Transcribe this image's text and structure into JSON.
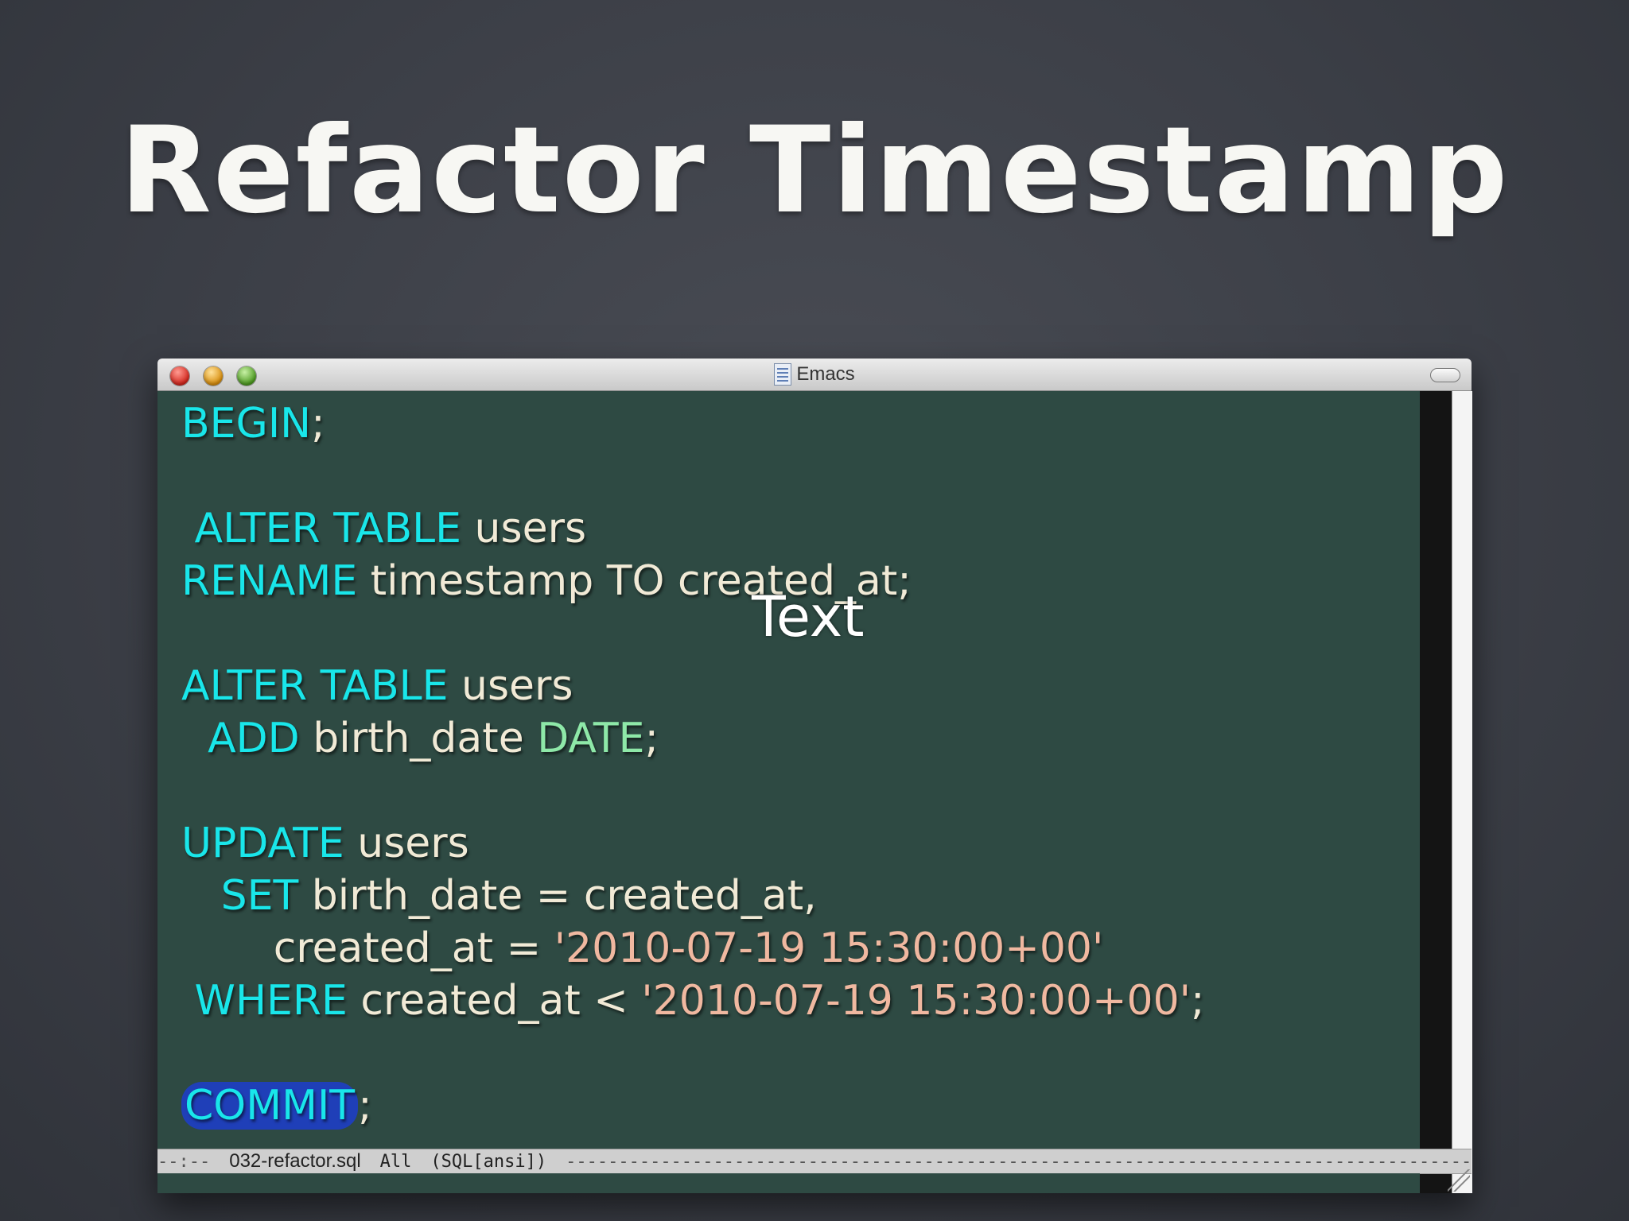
{
  "slide": {
    "title": "Refactor Timestamp"
  },
  "window": {
    "title": "Emacs",
    "icons": {
      "close": "close-traffic-light-icon",
      "minimize": "minimize-traffic-light-icon",
      "zoom": "zoom-traffic-light-icon",
      "document": "document-icon"
    }
  },
  "editor": {
    "theme": {
      "background": "#2e4a43",
      "keyword": "#19e6ea",
      "type": "#8ee8a8",
      "string": "#f0b8a0",
      "text": "#f1ead6"
    },
    "code": {
      "begin": "BEGIN",
      "semi": ";",
      "alter_table_1": "ALTER TABLE",
      "users_1": " users",
      "rename": "RENAME",
      "rename_rest": " timestamp TO created_at;",
      "alter_table_2": "ALTER TABLE",
      "users_2": " users",
      "add": "ADD",
      "add_rest": " birth_date ",
      "date_type": "DATE",
      "semi_2": ";",
      "update": "UPDATE",
      "users_3": " users",
      "set": "SET",
      "set_rest": " birth_date = created_at,",
      "created_at_assign": "created_at = ",
      "timestamp_literal_1": "'2010-07-19 15:30:00+00'",
      "where": "WHERE",
      "where_rest": " created_at < ",
      "timestamp_literal_2": "'2010-07-19 15:30:00+00'",
      "semi_3": ";",
      "commit": "COMMIT",
      "semi_4": ";"
    },
    "cursor_overlay_text": "Text"
  },
  "modeline": {
    "prefix": "--:--",
    "filename": "032-refactor.sql",
    "position": "All",
    "mode": "(SQL[ansi])",
    "fill": "-------------------------------------------------------------------------------------------------------------------"
  }
}
